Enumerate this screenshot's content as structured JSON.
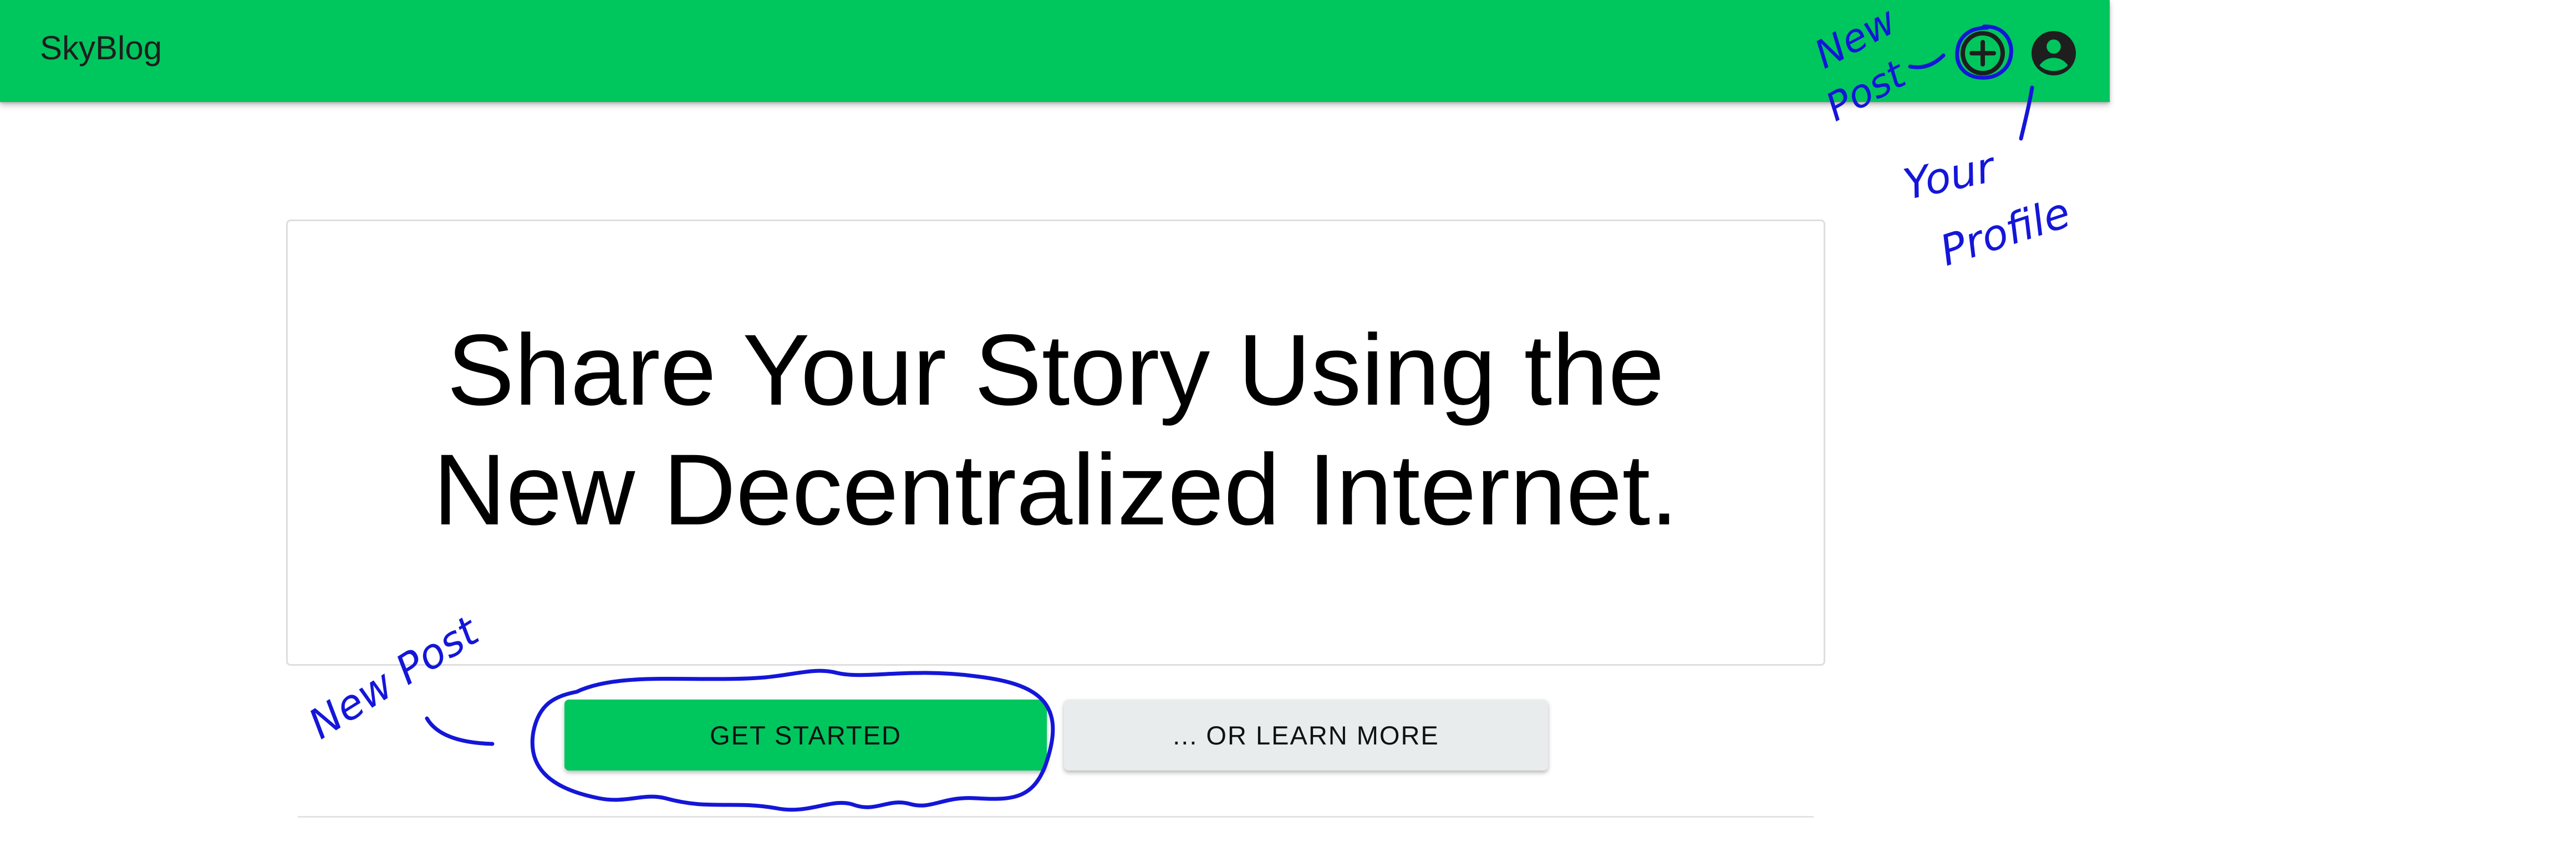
{
  "app": {
    "brand": "SkyBlog"
  },
  "header": {
    "add_icon": "plus-circle-icon",
    "profile_icon": "account-circle-icon",
    "color": "#00c65e"
  },
  "hero": {
    "title_line1": "Share Your Story Using the",
    "title_line2": "New Decentralized Internet."
  },
  "actions": {
    "get_started": "GET STARTED",
    "learn_more": "... OR LEARN MORE"
  },
  "annotations": {
    "new_post_top_1": "New",
    "new_post_top_2": "Post",
    "your_profile_1": "Your",
    "your_profile_2": "Profile",
    "new_post_left": "New Post",
    "ink_color": "#1416d8"
  }
}
